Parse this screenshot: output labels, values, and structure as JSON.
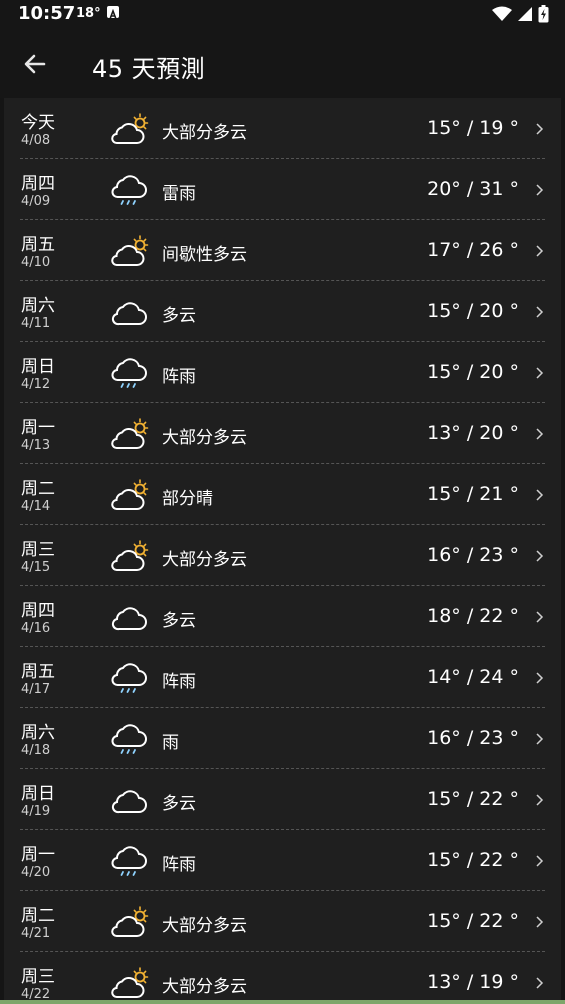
{
  "status_bar": {
    "time": "10:57",
    "temp": "18°",
    "icons": [
      "notification-a-icon",
      "wifi-icon",
      "signal-icon",
      "battery-charging-icon"
    ]
  },
  "app_bar": {
    "title": "45 天預測",
    "back_icon": "arrow-left-icon"
  },
  "colors": {
    "background": "#151515",
    "list_background": "#1f1f1f",
    "divider": "#555555",
    "sun": "#f2b233",
    "rain": "#8fd3ff"
  },
  "forecast": [
    {
      "day": "今天",
      "date": "4/08",
      "icon": "partly-cloudy-icon",
      "condition": "大部分多云",
      "temps": "15° / 19 °"
    },
    {
      "day": "周四",
      "date": "4/09",
      "icon": "rain-icon",
      "condition": "雷雨",
      "temps": "20° / 31 °"
    },
    {
      "day": "周五",
      "date": "4/10",
      "icon": "partly-cloudy-icon",
      "condition": "间歇性多云",
      "temps": "17° / 26 °"
    },
    {
      "day": "周六",
      "date": "4/11",
      "icon": "cloud-icon",
      "condition": "多云",
      "temps": "15° / 20 °"
    },
    {
      "day": "周日",
      "date": "4/12",
      "icon": "rain-icon",
      "condition": "阵雨",
      "temps": "15° / 20 °"
    },
    {
      "day": "周一",
      "date": "4/13",
      "icon": "partly-cloudy-icon",
      "condition": "大部分多云",
      "temps": "13° / 20 °"
    },
    {
      "day": "周二",
      "date": "4/14",
      "icon": "partly-cloudy-icon",
      "condition": "部分晴",
      "temps": "15° / 21 °"
    },
    {
      "day": "周三",
      "date": "4/15",
      "icon": "partly-cloudy-icon",
      "condition": "大部分多云",
      "temps": "16° / 23 °"
    },
    {
      "day": "周四",
      "date": "4/16",
      "icon": "cloud-icon",
      "condition": "多云",
      "temps": "18° / 22 °"
    },
    {
      "day": "周五",
      "date": "4/17",
      "icon": "rain-icon",
      "condition": "阵雨",
      "temps": "14° / 24 °"
    },
    {
      "day": "周六",
      "date": "4/18",
      "icon": "rain-icon",
      "condition": "雨",
      "temps": "16° / 23 °"
    },
    {
      "day": "周日",
      "date": "4/19",
      "icon": "cloud-icon",
      "condition": "多云",
      "temps": "15° / 22 °"
    },
    {
      "day": "周一",
      "date": "4/20",
      "icon": "rain-icon",
      "condition": "阵雨",
      "temps": "15° / 22 °"
    },
    {
      "day": "周二",
      "date": "4/21",
      "icon": "partly-cloudy-icon",
      "condition": "大部分多云",
      "temps": "15° / 22 °"
    },
    {
      "day": "周三",
      "date": "4/22",
      "icon": "partly-cloudy-icon",
      "condition": "大部分多云",
      "temps": "13° / 19 °"
    }
  ]
}
